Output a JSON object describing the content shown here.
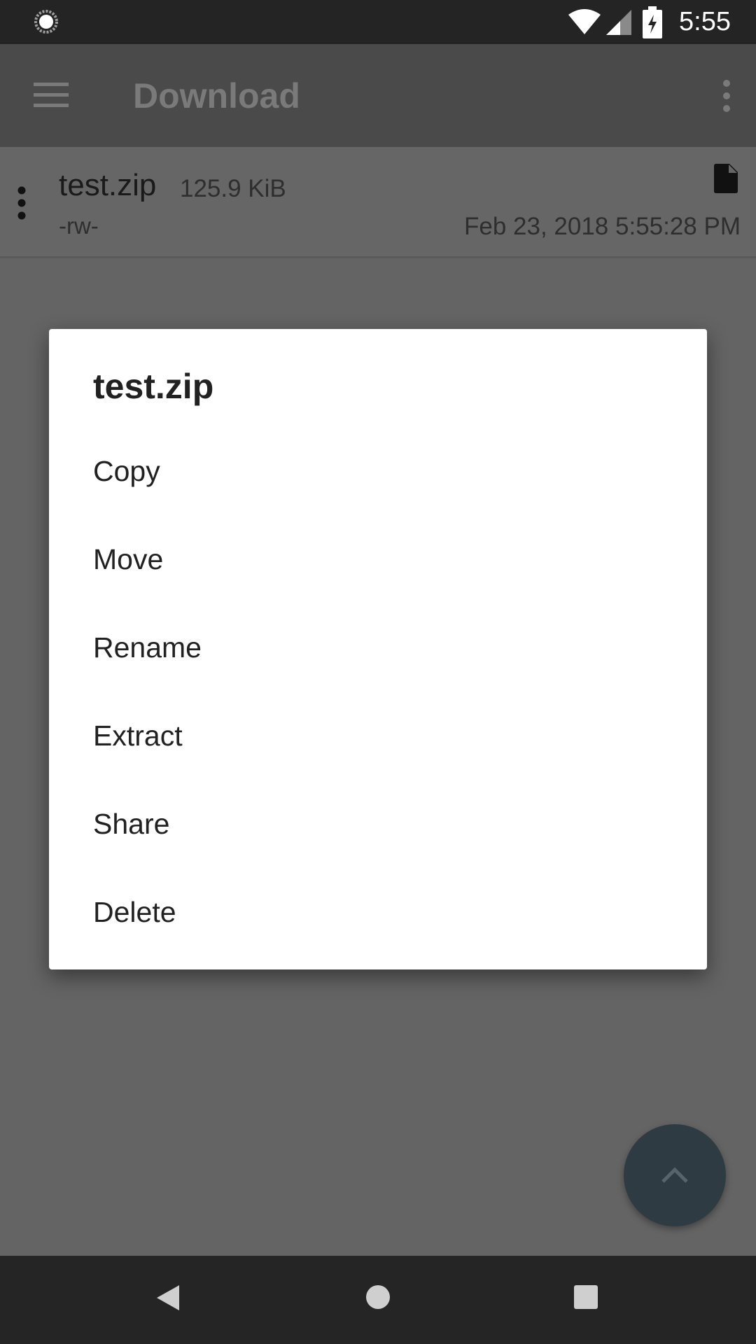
{
  "status_bar": {
    "time": "5:55",
    "icons": [
      "sync-icon",
      "wifi-icon",
      "cell-signal-icon",
      "battery-charging-icon"
    ]
  },
  "app_bar": {
    "title": "Download",
    "icons": [
      "menu-icon",
      "overflow-menu-icon"
    ]
  },
  "file_list": {
    "items": [
      {
        "name": "test.zip",
        "size": "125.9 KiB",
        "permissions": "-rw-",
        "modified": "Feb 23, 2018 5:55:28 PM",
        "icon": "file-icon"
      }
    ]
  },
  "dialog": {
    "title": "test.zip",
    "items": [
      {
        "label": "Copy"
      },
      {
        "label": "Move"
      },
      {
        "label": "Rename"
      },
      {
        "label": "Extract"
      },
      {
        "label": "Share"
      },
      {
        "label": "Delete"
      }
    ]
  },
  "fab": {
    "icon": "chevron-up-icon"
  },
  "nav_bar": {
    "icons": [
      "back-icon",
      "home-icon",
      "recents-icon"
    ]
  },
  "colors": {
    "status_bar": "#242424",
    "app_bar": "#4a4a4a",
    "scrim_content": "#646464",
    "dialog_bg": "#ffffff",
    "fab": "#2f3b43",
    "nav_bar": "#252525"
  }
}
